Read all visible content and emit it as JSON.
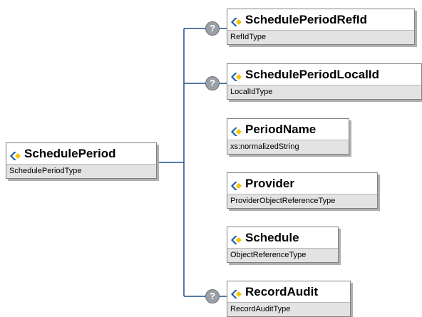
{
  "root": {
    "name": "SchedulePeriod",
    "type": "SchedulePeriodType"
  },
  "children": [
    {
      "name": "SchedulePeriodRefId",
      "type": "RefIdType",
      "optional": true
    },
    {
      "name": "SchedulePeriodLocalId",
      "type": "LocalIdType",
      "optional": true
    },
    {
      "name": "PeriodName",
      "type": "xs:normalizedString",
      "optional": false
    },
    {
      "name": "Provider",
      "type": "ProviderObjectReferenceType",
      "optional": false
    },
    {
      "name": "Schedule",
      "type": "ObjectReferenceType",
      "optional": false
    },
    {
      "name": "RecordAudit",
      "type": "RecordAuditType",
      "optional": true
    }
  ],
  "optional_marker": "?",
  "colors": {
    "connector": "#1f4e8c",
    "type_band": "#e3e3e3",
    "icon_blue": "#1a5fa8",
    "icon_yellow": "#f2c200"
  }
}
